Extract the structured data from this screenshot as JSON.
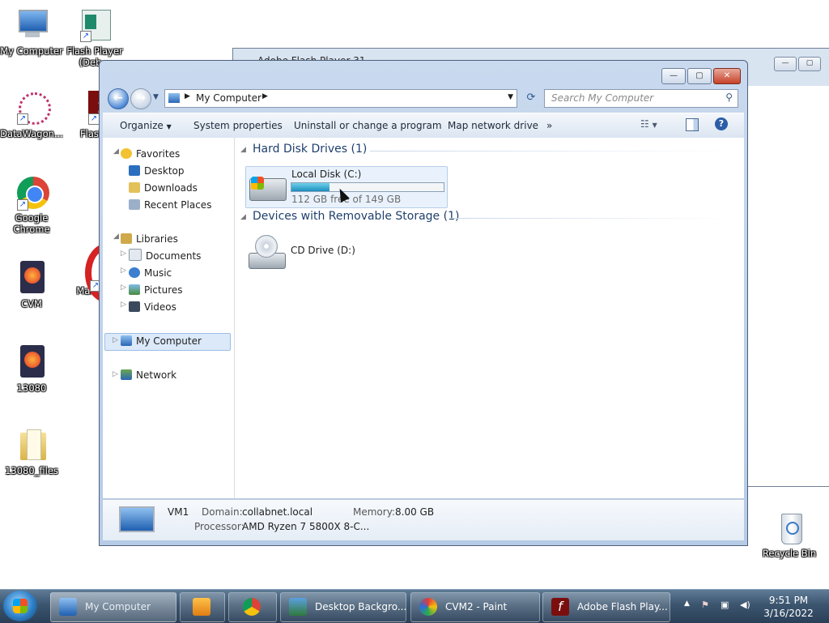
{
  "desktop": {
    "icons": [
      {
        "label": "My Computer"
      },
      {
        "label": "Flash Player (Deb..."
      },
      {
        "label": "DataWagon..."
      },
      {
        "label": "Flash P..."
      },
      {
        "label": "Google Chrome"
      },
      {
        "label": "CVM"
      },
      {
        "label": "Malware..."
      },
      {
        "label": "13080"
      },
      {
        "label": "13080_files"
      },
      {
        "label": "Recycle Bin"
      }
    ]
  },
  "background_window": {
    "title": "Adobe Flash Player 31"
  },
  "explorer": {
    "address": {
      "crumb": "My Computer"
    },
    "search": {
      "placeholder": "Search My Computer"
    },
    "toolbar": {
      "organize": "Organize",
      "system_properties": "System properties",
      "uninstall": "Uninstall or change a program",
      "map_network": "Map network drive",
      "more": "»"
    },
    "nav": {
      "favorites": "Favorites",
      "desktop": "Desktop",
      "downloads": "Downloads",
      "recent_places": "Recent Places",
      "libraries": "Libraries",
      "documents": "Documents",
      "music": "Music",
      "pictures": "Pictures",
      "videos": "Videos",
      "my_computer": "My Computer",
      "network": "Network"
    },
    "groups": {
      "hard_disks": "Hard Disk Drives (1)",
      "removable": "Devices with Removable Storage (1)"
    },
    "drive_c": {
      "name": "Local Disk (C:)",
      "free_text": "112 GB free of 149 GB",
      "used_fraction": 0.25
    },
    "drive_d": {
      "name": "CD Drive (D:)"
    },
    "details": {
      "computer_name": "VM1",
      "domain_label": "Domain:",
      "domain_value": "collabnet.local",
      "memory_label": "Memory:",
      "memory_value": "8.00 GB",
      "processor_label": "Processor:",
      "processor_value": "AMD Ryzen 7 5800X 8-C..."
    }
  },
  "taskbar": {
    "tasks": [
      {
        "label": "My Computer"
      },
      {
        "label": "Desktop Backgro..."
      },
      {
        "label": "CVM2 - Paint"
      },
      {
        "label": "Adobe Flash Play..."
      }
    ],
    "clock": {
      "time": "9:51 PM",
      "date": "3/16/2022"
    }
  },
  "colors": {
    "accent": "#2d7fc6",
    "usage_bar": "#1b8fbf",
    "taskbar": "#3c556f"
  }
}
